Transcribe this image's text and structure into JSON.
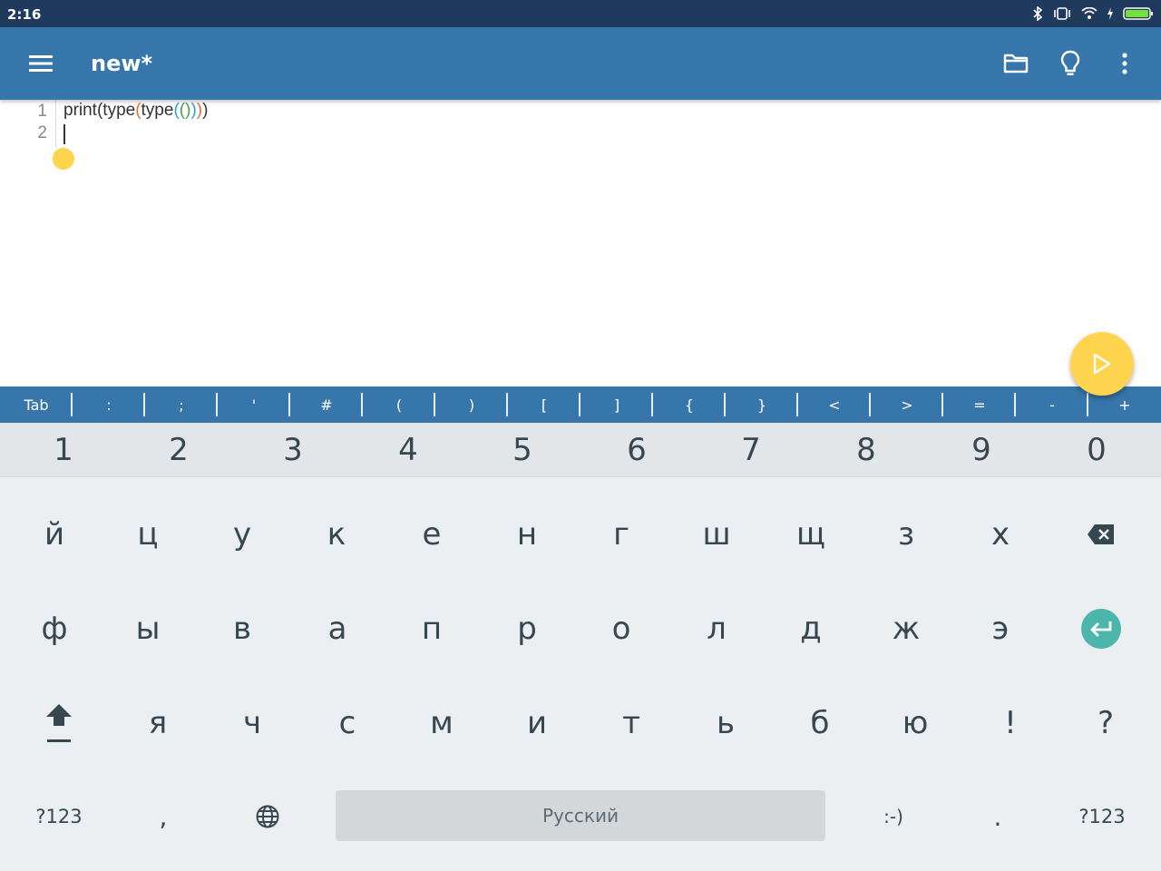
{
  "status_bar": {
    "time": "2:16",
    "icons": [
      "bluetooth-icon",
      "vibrate-icon",
      "wifi-icon",
      "charging-icon",
      "battery-icon"
    ]
  },
  "app_bar": {
    "title": "new*",
    "actions": [
      "folder-icon",
      "lightbulb-icon",
      "more-vert-icon"
    ],
    "color": "#3776ab"
  },
  "editor": {
    "line_numbers": [
      "1",
      "2"
    ],
    "code_tokens": [
      {
        "text": "print(type",
        "color": "dark"
      },
      {
        "text": "(",
        "color": "orange"
      },
      {
        "text": "type",
        "color": "dark"
      },
      {
        "text": "(",
        "color": "blue"
      },
      {
        "text": "(",
        "color": "green"
      },
      {
        "text": ")",
        "color": "green"
      },
      {
        "text": ")",
        "color": "blue"
      },
      {
        "text": ")",
        "color": "orange"
      },
      {
        "text": ")",
        "color": "dark"
      }
    ]
  },
  "run_button": {
    "icon": "play-icon",
    "color": "#ffd54f"
  },
  "symbol_bar": [
    "Tab",
    ":",
    ";",
    "'",
    "#",
    "(",
    ")",
    "[",
    "]",
    "{",
    "}",
    "<",
    ">",
    "=",
    "-",
    "+"
  ],
  "keyboard": {
    "number_row": [
      "1",
      "2",
      "3",
      "4",
      "5",
      "6",
      "7",
      "8",
      "9",
      "0"
    ],
    "row1": [
      "й",
      "ц",
      "у",
      "к",
      "е",
      "н",
      "г",
      "ш",
      "щ",
      "з",
      "х"
    ],
    "row2": [
      "ф",
      "ы",
      "в",
      "а",
      "п",
      "р",
      "о",
      "л",
      "д",
      "ж",
      "э"
    ],
    "row3": [
      "я",
      "ч",
      "с",
      "м",
      "и",
      "т",
      "ь",
      "б",
      "ю",
      "!",
      "?"
    ],
    "bottom": {
      "symbols_left": "?123",
      "comma": ",",
      "space_label": "Русский",
      "emoticon": ":-)",
      "period": ".",
      "symbols_right": "?123"
    },
    "enter_color": "#4db6ac"
  }
}
